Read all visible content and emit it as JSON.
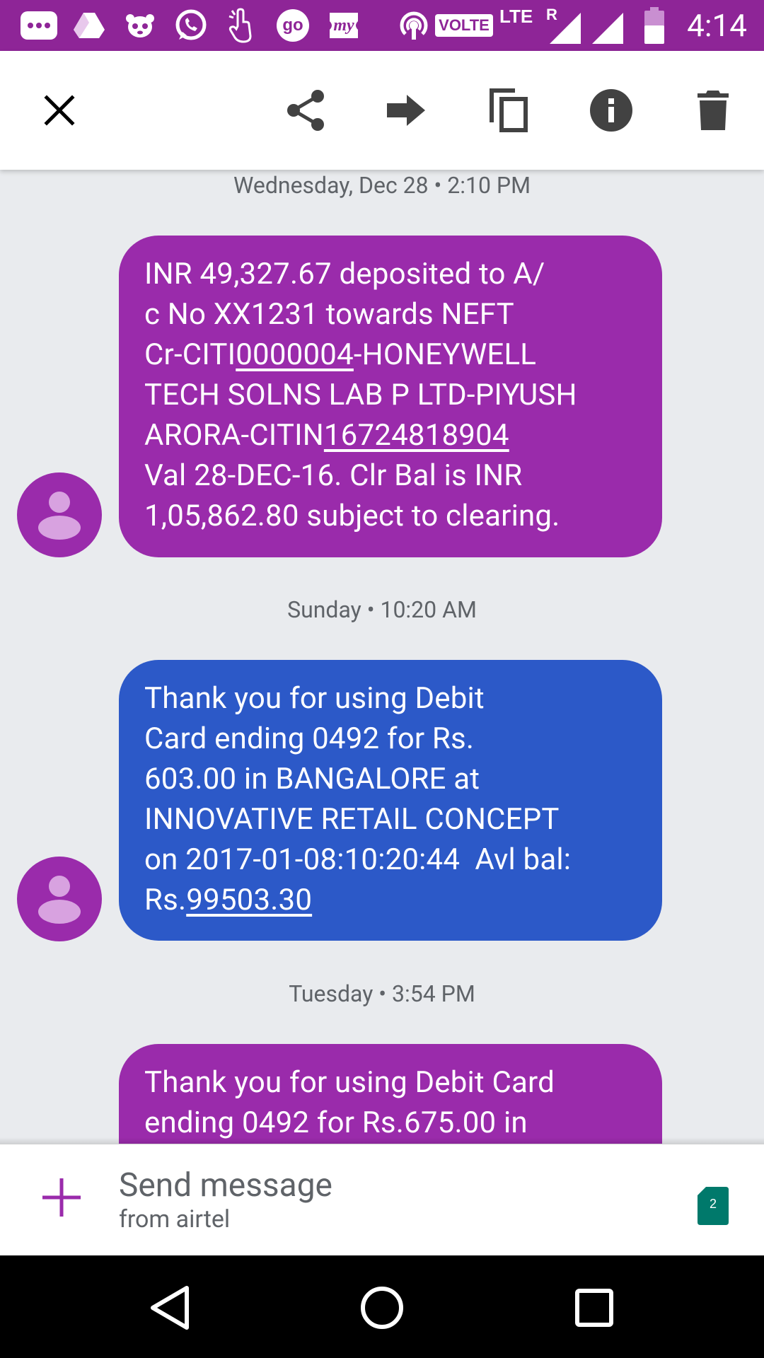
{
  "status_bar": {
    "time": "4:14",
    "volte_label": "VOLTE",
    "lte_label": "LTE",
    "roaming_label": "R",
    "go_label": "go",
    "my_label": "my",
    "background": "#8e2597"
  },
  "toolbar": {
    "icons": [
      "close-icon",
      "share-icon",
      "forward-icon",
      "copy-icon",
      "info-icon",
      "delete-icon"
    ]
  },
  "messages": [
    {
      "timestamp": "Wednesday, Dec 28 • 2:10 PM",
      "color": "#9a2bab",
      "lines": [
        [
          "INR 49,327.67 deposited to A/"
        ],
        [
          "c No XX1231 towards NEFT"
        ],
        [
          "Cr-CITI",
          "0000004",
          "-HONEYWELL"
        ],
        [
          "TECH SOLNS LAB P LTD-PIYUSH"
        ],
        [
          "ARORA-CITIN",
          "16724818904"
        ],
        [
          "Val 28-DEC-16. Clr Bal is INR"
        ],
        [
          "1,05,862.80 subject to clearing."
        ]
      ]
    },
    {
      "timestamp": "Sunday • 10:20 AM",
      "color": "#2c59c8",
      "lines": [
        [
          "Thank you for using Debit"
        ],
        [
          "Card ending 0492 for Rs."
        ],
        [
          "603.00 in BANGALORE at"
        ],
        [
          "INNOVATIVE RETAIL CONCEPT"
        ],
        [
          "on 2017-01-08:10:20:44  Avl bal:"
        ],
        [
          "Rs.",
          "99503.30"
        ]
      ]
    },
    {
      "timestamp": "Tuesday • 3:54 PM",
      "color": "#9a2bab",
      "lines": [
        [
          "Thank you for using Debit Card"
        ],
        [
          "ending 0492 for Rs.675.00 in"
        ]
      ]
    }
  ],
  "compose": {
    "placeholder": "Send message",
    "subtitle": "from airtel",
    "sim_number": "2",
    "sim_color": "#00796b",
    "accent": "#9a2bab"
  },
  "nav_bar": {
    "icons": [
      "back-icon",
      "home-icon",
      "recents-icon"
    ]
  }
}
